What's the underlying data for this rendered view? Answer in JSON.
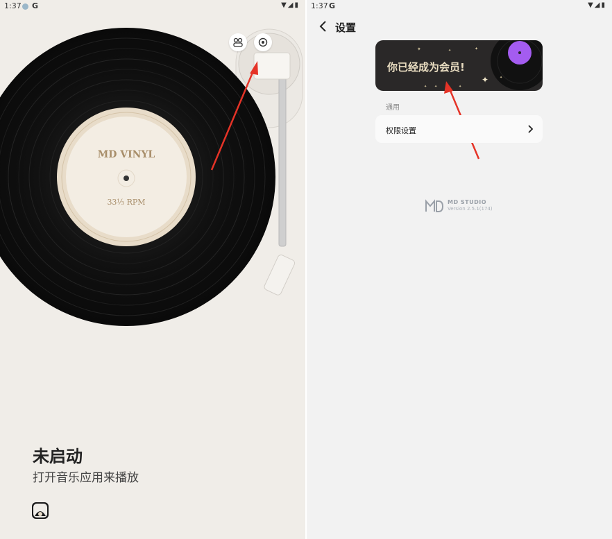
{
  "left_panel": {
    "status_bar": {
      "time": "1:37",
      "g_label": "G"
    },
    "record": {
      "label_title": "MD VINYL",
      "label_speed": "33⅓ RPM"
    },
    "player_status": {
      "title": "未启动",
      "subtitle": "打开音乐应用来播放"
    },
    "icons": [
      "people-icon",
      "settings-icon",
      "app-vinyl-icon"
    ]
  },
  "right_panel": {
    "status_bar": {
      "time": "1:37",
      "g_label": "G"
    },
    "header": {
      "title": "设置"
    },
    "member_card": {
      "text": "你已经成为会员!",
      "accent_color": "#a45cf0"
    },
    "section_label": "通用",
    "permission_row": {
      "label": "权限设置"
    },
    "brand": {
      "name": "MD STUDIO",
      "version": "Version 2.5.1(174)"
    }
  },
  "annotation": {
    "arrow_color": "#e53327"
  }
}
